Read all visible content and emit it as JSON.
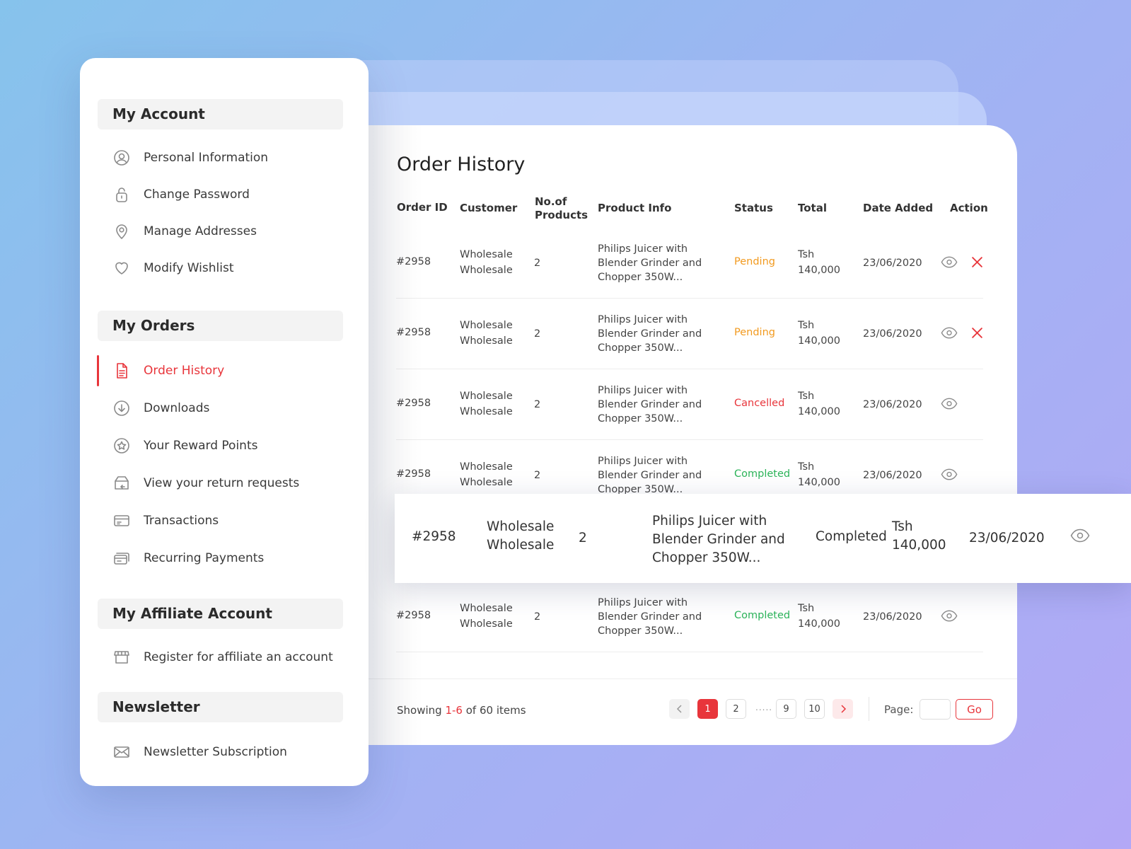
{
  "sidebar": {
    "sections": [
      {
        "title": "My Account",
        "items": [
          {
            "label": "Personal Information",
            "icon": "user-circle-icon"
          },
          {
            "label": "Change Password",
            "icon": "lock-icon"
          },
          {
            "label": "Manage Addresses",
            "icon": "map-pin-icon"
          },
          {
            "label": "Modify Wishlist",
            "icon": "heart-icon"
          }
        ]
      },
      {
        "title": "My Orders",
        "items": [
          {
            "label": "Order History",
            "icon": "document-icon",
            "active": true
          },
          {
            "label": "Downloads",
            "icon": "download-icon"
          },
          {
            "label": "Your Reward Points",
            "icon": "star-badge-icon"
          },
          {
            "label": "View your return requests",
            "icon": "return-box-icon"
          },
          {
            "label": "Transactions",
            "icon": "card-icon"
          },
          {
            "label": "Recurring Payments",
            "icon": "recurring-card-icon"
          }
        ]
      },
      {
        "title": "My Affiliate Account",
        "items": [
          {
            "label": "Register for affiliate an account",
            "icon": "store-icon"
          }
        ]
      },
      {
        "title": "Newsletter",
        "items": [
          {
            "label": "Newsletter Subscription",
            "icon": "mail-icon"
          }
        ]
      }
    ]
  },
  "main": {
    "title": "Order History",
    "columns": [
      "Order ID",
      "Customer",
      "No.of",
      "Products",
      "Product Info",
      "Status",
      "Total",
      "Date Added",
      "Action"
    ],
    "rows": [
      {
        "id": "#2958",
        "customer1": "Wholesale",
        "customer2": "Wholesale",
        "qty": "2",
        "info1": "Philips Juicer with",
        "info2": "Blender Grinder and",
        "info3": "Chopper 350W...",
        "status": "Pending",
        "total1": "Tsh",
        "total2": "140,000",
        "date": "23/06/2020"
      },
      {
        "id": "#2958",
        "customer1": "Wholesale",
        "customer2": "Wholesale",
        "qty": "2",
        "info1": "Philips Juicer with",
        "info2": "Blender Grinder and",
        "info3": "Chopper 350W...",
        "status": "Pending",
        "total1": "Tsh",
        "total2": "140,000",
        "date": "23/06/2020"
      },
      {
        "id": "#2958",
        "customer1": "Wholesale",
        "customer2": "Wholesale",
        "qty": "2",
        "info1": "Philips Juicer with",
        "info2": "Blender Grinder and",
        "info3": "Chopper 350W...",
        "status": "Cancelled",
        "total1": "Tsh",
        "total2": "140,000",
        "date": "23/06/2020"
      },
      {
        "id": "#2958",
        "customer1": "Wholesale",
        "customer2": "Wholesale",
        "qty": "2",
        "info1": "Philips Juicer with",
        "info2": "Blender Grinder and",
        "info3": "Chopper 350W...",
        "status": "Completed",
        "total1": "Tsh",
        "total2": "140,000",
        "date": "23/06/2020"
      },
      {
        "id": "#2958",
        "customer1": "Wholesale",
        "customer2": "Wholesale",
        "qty": "2",
        "info1": "Philips Juicer with",
        "info2": "Blender Grinder and",
        "info3": "Chopper 350W...",
        "status": "Completed",
        "total1": "Tsh",
        "total2": "140,000",
        "date": "23/06/2020"
      }
    ],
    "highlight_row": {
      "id": "#2958",
      "customer1": "Wholesale",
      "customer2": "Wholesale",
      "qty": "2",
      "info1": "Philips Juicer with",
      "info2": "Blender Grinder and",
      "info3": "Chopper 350W...",
      "status": "Completed",
      "total1": "Tsh",
      "total2": "140,000",
      "date": "23/06/2020"
    },
    "footer": {
      "showing_prefix": "Showing",
      "showing_range": "1-6",
      "showing_suffix": "of 60 items",
      "pages": [
        "1",
        "2",
        "9",
        "10"
      ],
      "dots": ".....",
      "page_label": "Page:",
      "go_label": "Go"
    }
  },
  "colors": {
    "accent": "#e8353b",
    "pending": "#f29a1f",
    "completed": "#2cb45a"
  }
}
